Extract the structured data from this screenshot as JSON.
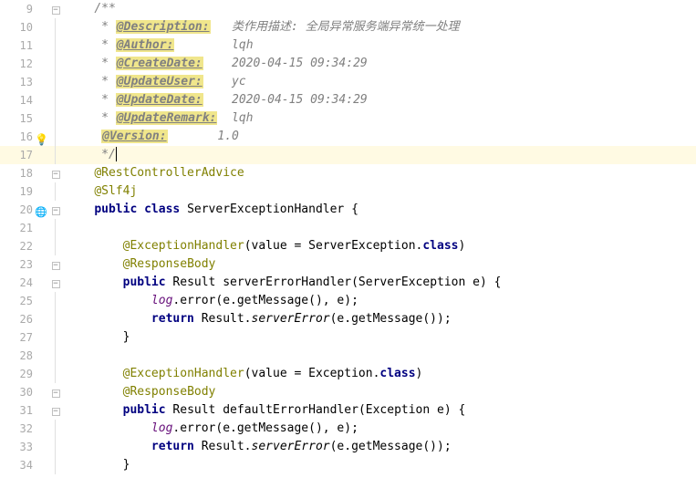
{
  "lines": [
    {
      "n": 9,
      "fold": "minus",
      "spans": [
        {
          "cls": "comment",
          "t": "/**"
        }
      ],
      "indent": "    "
    },
    {
      "n": 10,
      "spans": [
        {
          "cls": "comment",
          "t": " * "
        },
        {
          "cls": "doc-tag-hl",
          "t": "@Description:"
        },
        {
          "cls": "comment",
          "t": "   类作用描述: 全局异常服务端异常统一处理"
        }
      ],
      "indent": "    "
    },
    {
      "n": 11,
      "spans": [
        {
          "cls": "comment",
          "t": " * "
        },
        {
          "cls": "doc-tag-hl",
          "t": "@Author:"
        },
        {
          "cls": "comment",
          "t": "        lqh"
        }
      ],
      "indent": "    "
    },
    {
      "n": 12,
      "spans": [
        {
          "cls": "comment",
          "t": " * "
        },
        {
          "cls": "doc-tag-hl",
          "t": "@CreateDate:"
        },
        {
          "cls": "comment",
          "t": "    2020-04-15 09:34:29"
        }
      ],
      "indent": "    "
    },
    {
      "n": 13,
      "spans": [
        {
          "cls": "comment",
          "t": " * "
        },
        {
          "cls": "doc-tag-hl",
          "t": "@UpdateUser:"
        },
        {
          "cls": "comment",
          "t": "    yc"
        }
      ],
      "indent": "    "
    },
    {
      "n": 14,
      "spans": [
        {
          "cls": "comment",
          "t": " * "
        },
        {
          "cls": "doc-tag-hl",
          "t": "@UpdateDate:"
        },
        {
          "cls": "comment",
          "t": "    2020-04-15 09:34:29"
        }
      ],
      "indent": "    "
    },
    {
      "n": 15,
      "spans": [
        {
          "cls": "comment",
          "t": " * "
        },
        {
          "cls": "doc-tag-hl",
          "t": "@UpdateRemark:"
        },
        {
          "cls": "comment",
          "t": "  lqh"
        }
      ],
      "indent": "    "
    },
    {
      "n": 16,
      "icon": "bulb",
      "spans": [
        {
          "cls": "doc-tag-hl",
          "t": "@Version:"
        },
        {
          "cls": "comment",
          "t": "       1.0"
        }
      ],
      "indent": "     "
    },
    {
      "n": 17,
      "highlight": true,
      "cursor": true,
      "spans": [
        {
          "cls": "comment",
          "t": " */"
        }
      ],
      "indent": "    "
    },
    {
      "n": 18,
      "fold": "minus",
      "spans": [
        {
          "cls": "annotation",
          "t": "@RestControllerAdvice"
        }
      ],
      "indent": "    "
    },
    {
      "n": 19,
      "spans": [
        {
          "cls": "annotation",
          "t": "@Slf4j"
        }
      ],
      "indent": "    "
    },
    {
      "n": 20,
      "icon": "globe",
      "fold": "minus",
      "spans": [
        {
          "cls": "keyword",
          "t": "public class "
        },
        {
          "cls": "plain",
          "t": "ServerExceptionHandler {"
        }
      ],
      "indent": "    "
    },
    {
      "n": 21,
      "spans": [],
      "indent": ""
    },
    {
      "n": 22,
      "spans": [
        {
          "cls": "annotation",
          "t": "@ExceptionHandler"
        },
        {
          "cls": "plain",
          "t": "(value = ServerException."
        },
        {
          "cls": "keyword",
          "t": "class"
        },
        {
          "cls": "plain",
          "t": ")"
        }
      ],
      "indent": "        "
    },
    {
      "n": 23,
      "fold": "minus",
      "spans": [
        {
          "cls": "annotation",
          "t": "@ResponseBody"
        }
      ],
      "indent": "        "
    },
    {
      "n": 24,
      "fold": "minus",
      "spans": [
        {
          "cls": "keyword",
          "t": "public "
        },
        {
          "cls": "plain",
          "t": "Result "
        },
        {
          "cls": "method-decl",
          "t": "serverErrorHandler"
        },
        {
          "cls": "plain",
          "t": "(ServerException e) {"
        }
      ],
      "indent": "        "
    },
    {
      "n": 25,
      "spans": [
        {
          "cls": "ident",
          "t": "log"
        },
        {
          "cls": "plain",
          "t": ".error(e.getMessage(), e);"
        }
      ],
      "indent": "            "
    },
    {
      "n": 26,
      "spans": [
        {
          "cls": "keyword",
          "t": "return "
        },
        {
          "cls": "plain",
          "t": "Result."
        },
        {
          "cls": "static-method",
          "t": "serverError"
        },
        {
          "cls": "plain",
          "t": "(e.getMessage());"
        }
      ],
      "indent": "            "
    },
    {
      "n": 27,
      "fold": "end",
      "spans": [
        {
          "cls": "plain",
          "t": "}"
        }
      ],
      "indent": "        "
    },
    {
      "n": 28,
      "spans": [],
      "indent": ""
    },
    {
      "n": 29,
      "spans": [
        {
          "cls": "annotation",
          "t": "@ExceptionHandler"
        },
        {
          "cls": "plain",
          "t": "(value = Exception."
        },
        {
          "cls": "keyword",
          "t": "class"
        },
        {
          "cls": "plain",
          "t": ")"
        }
      ],
      "indent": "        "
    },
    {
      "n": 30,
      "fold": "minus",
      "spans": [
        {
          "cls": "annotation",
          "t": "@ResponseBody"
        }
      ],
      "indent": "        "
    },
    {
      "n": 31,
      "fold": "minus",
      "spans": [
        {
          "cls": "keyword",
          "t": "public "
        },
        {
          "cls": "plain",
          "t": "Result "
        },
        {
          "cls": "method-decl",
          "t": "defaultErrorHandler"
        },
        {
          "cls": "plain",
          "t": "(Exception e) {"
        }
      ],
      "indent": "        "
    },
    {
      "n": 32,
      "spans": [
        {
          "cls": "ident",
          "t": "log"
        },
        {
          "cls": "plain",
          "t": ".error(e.getMessage(), e);"
        }
      ],
      "indent": "            "
    },
    {
      "n": 33,
      "spans": [
        {
          "cls": "keyword",
          "t": "return "
        },
        {
          "cls": "plain",
          "t": "Result."
        },
        {
          "cls": "static-method",
          "t": "serverError"
        },
        {
          "cls": "plain",
          "t": "(e.getMessage());"
        }
      ],
      "indent": "            "
    },
    {
      "n": 34,
      "fold": "end",
      "spans": [
        {
          "cls": "plain",
          "t": "}"
        }
      ],
      "indent": "        "
    }
  ],
  "icons": {
    "bulb": "💡",
    "globe": "🌐"
  }
}
